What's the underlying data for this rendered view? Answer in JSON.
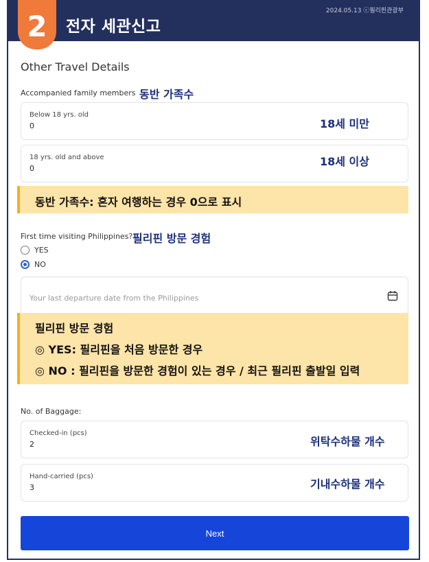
{
  "header": {
    "step_number": "2",
    "title": "전자 세관신고",
    "meta": "2024.05.13 ⓒ필리핀관광부"
  },
  "section_title": "Other Travel Details",
  "family": {
    "label": "Accompanied family members",
    "annotation": "동반 가족수",
    "below18": {
      "label": "Below 18 yrs. old",
      "value": "0",
      "annotation": "18세 미만"
    },
    "above18": {
      "label": "18 yrs. old and above",
      "value": "0",
      "annotation": "18세 이상"
    },
    "note": "동반 가족수: 혼자 여행하는 경우 0으로 표시"
  },
  "first_visit": {
    "question": "First time visiting Philippines?",
    "annotation": "필리핀 방문 경험",
    "options": [
      "YES",
      "NO"
    ],
    "selected": "NO",
    "date_placeholder": "Your last departure date from the Philippines",
    "date_value": "",
    "note_lines": [
      "필리핀 방문 경험",
      "◎ YES: 필리핀을 처음 방문한 경우",
      "◎ NO : 필리핀을 방문한 경험이 있는 경우 / 최근 필리핀 출발일 입력"
    ]
  },
  "baggage": {
    "label": "No. of Baggage:",
    "checked": {
      "label": "Checked-in (pcs)",
      "value": "2",
      "annotation": "위탁수하물 개수"
    },
    "hand": {
      "label": "Hand-carried (pcs)",
      "value": "3",
      "annotation": "기내수하물 개수"
    }
  },
  "next_button": "Next",
  "colors": {
    "header_bg": "#23305e",
    "step_tab": "#f07a3a",
    "annotation_text": "#1a2f7a",
    "note_bg": "#fde4a8",
    "note_border": "#f2b11e",
    "button_bg": "#1546d9",
    "radio_selected": "#2f5ec8"
  },
  "icons": {
    "date_picker": "calendar-icon"
  }
}
